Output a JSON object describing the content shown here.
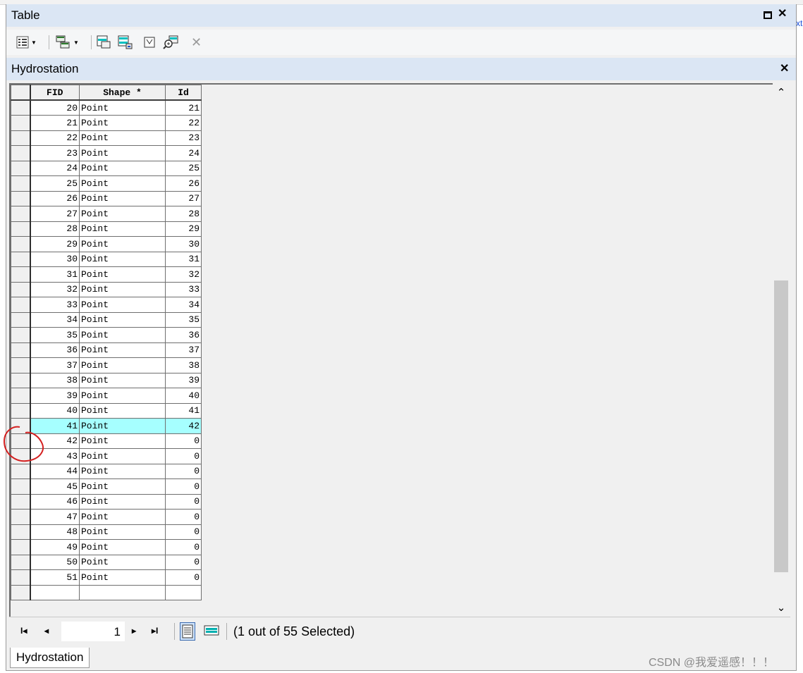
{
  "window": {
    "title": "Table"
  },
  "edge_link_text": "xt",
  "toolbar": {
    "buttons": [
      "table-options",
      "related-tables",
      "select-by-attributes",
      "switch-selection",
      "clear-selection",
      "zoom-to-selected",
      "delete-selected"
    ]
  },
  "table_tab": {
    "name": "Hydrostation"
  },
  "columns": [
    "FID",
    "Shape *",
    "Id"
  ],
  "rows": [
    {
      "fid": "20",
      "shape": "Point",
      "id": "21"
    },
    {
      "fid": "21",
      "shape": "Point",
      "id": "22"
    },
    {
      "fid": "22",
      "shape": "Point",
      "id": "23"
    },
    {
      "fid": "23",
      "shape": "Point",
      "id": "24"
    },
    {
      "fid": "24",
      "shape": "Point",
      "id": "25"
    },
    {
      "fid": "25",
      "shape": "Point",
      "id": "26"
    },
    {
      "fid": "26",
      "shape": "Point",
      "id": "27"
    },
    {
      "fid": "27",
      "shape": "Point",
      "id": "28"
    },
    {
      "fid": "28",
      "shape": "Point",
      "id": "29"
    },
    {
      "fid": "29",
      "shape": "Point",
      "id": "30"
    },
    {
      "fid": "30",
      "shape": "Point",
      "id": "31"
    },
    {
      "fid": "31",
      "shape": "Point",
      "id": "32"
    },
    {
      "fid": "32",
      "shape": "Point",
      "id": "33"
    },
    {
      "fid": "33",
      "shape": "Point",
      "id": "34"
    },
    {
      "fid": "34",
      "shape": "Point",
      "id": "35"
    },
    {
      "fid": "35",
      "shape": "Point",
      "id": "36"
    },
    {
      "fid": "36",
      "shape": "Point",
      "id": "37"
    },
    {
      "fid": "37",
      "shape": "Point",
      "id": "38"
    },
    {
      "fid": "38",
      "shape": "Point",
      "id": "39"
    },
    {
      "fid": "39",
      "shape": "Point",
      "id": "40"
    },
    {
      "fid": "40",
      "shape": "Point",
      "id": "41"
    },
    {
      "fid": "41",
      "shape": "Point",
      "id": "42",
      "selected": true
    },
    {
      "fid": "42",
      "shape": "Point",
      "id": "0"
    },
    {
      "fid": "43",
      "shape": "Point",
      "id": "0"
    },
    {
      "fid": "44",
      "shape": "Point",
      "id": "0"
    },
    {
      "fid": "45",
      "shape": "Point",
      "id": "0"
    },
    {
      "fid": "46",
      "shape": "Point",
      "id": "0"
    },
    {
      "fid": "47",
      "shape": "Point",
      "id": "0"
    },
    {
      "fid": "48",
      "shape": "Point",
      "id": "0"
    },
    {
      "fid": "49",
      "shape": "Point",
      "id": "0"
    },
    {
      "fid": "50",
      "shape": "Point",
      "id": "0"
    },
    {
      "fid": "51",
      "shape": "Point",
      "id": "0"
    },
    {
      "fid": "",
      "shape": "",
      "id": ""
    }
  ],
  "navigation": {
    "current_record": "1",
    "selection_status": "(1 out of 55 Selected)"
  },
  "bottom_tab": {
    "label": "Hydrostation"
  },
  "watermark": "CSDN @我爱遥感！！！",
  "colors": {
    "selected_row": "#a6ffff",
    "header_bar": "#dbe6f4",
    "annotation": "#d42020"
  }
}
